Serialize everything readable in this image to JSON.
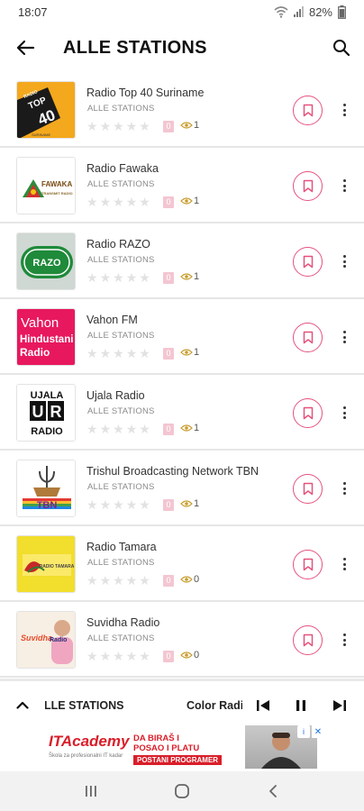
{
  "status_bar": {
    "time": "18:07",
    "battery": "82%"
  },
  "header": {
    "title": "ALLE STATIONS"
  },
  "stations": [
    {
      "name": "Radio Top 40 Suriname",
      "category": "ALLE STATIONS",
      "rating": "0",
      "views": "1"
    },
    {
      "name": "Radio Fawaka",
      "category": "ALLE STATIONS",
      "rating": "0",
      "views": "1"
    },
    {
      "name": "Radio RAZO",
      "category": "ALLE STATIONS",
      "rating": "0",
      "views": "1"
    },
    {
      "name": "Vahon FM",
      "category": "ALLE STATIONS",
      "rating": "0",
      "views": "1"
    },
    {
      "name": "Ujala Radio",
      "category": "ALLE STATIONS",
      "rating": "0",
      "views": "1"
    },
    {
      "name": "Trishul Broadcasting Network TBN",
      "category": "ALLE STATIONS",
      "rating": "0",
      "views": "1"
    },
    {
      "name": "Radio Tamara",
      "category": "ALLE STATIONS",
      "rating": "0",
      "views": "0"
    },
    {
      "name": "Suvidha Radio",
      "category": "ALLE STATIONS",
      "rating": "0",
      "views": "0"
    }
  ],
  "logos": {
    "top40": {
      "line1": "RADIO",
      "line2": "TOP",
      "line3": "40",
      "line4": "SURINAME"
    },
    "fawaka": {
      "line1": "FAWAKA",
      "line2": "TRANSMIT RADIO"
    },
    "razo": {
      "text": "RAZO"
    },
    "vahon": {
      "line1": "Vahon",
      "line2": "Hindustani",
      "line3": "Radio"
    },
    "ujala": {
      "line1": "UJALA",
      "line2": "U",
      "line3": "R",
      "line4": "RADIO"
    },
    "tbn": {
      "text": "TBN"
    },
    "tamara": {
      "text": "RADIO TAMARA"
    },
    "suvidha": {
      "text1": "Suvidha",
      "text2": "Radio"
    }
  },
  "player": {
    "category": "ALLE STATIONS",
    "title": "Color Radio"
  },
  "ad": {
    "brand": "ITAcademy",
    "brand_sub": "Škola za profesionalni IT kadar",
    "headline_1": "DA BIRAŠ I",
    "headline_2": "POSAO I PLATU",
    "cta": "POSTANI PROGRAMER",
    "info": "i",
    "close": "✕"
  },
  "colors": {
    "accent": "#e5527d",
    "star_empty": "#e2e2e2",
    "badge": "#f3c6d2"
  }
}
